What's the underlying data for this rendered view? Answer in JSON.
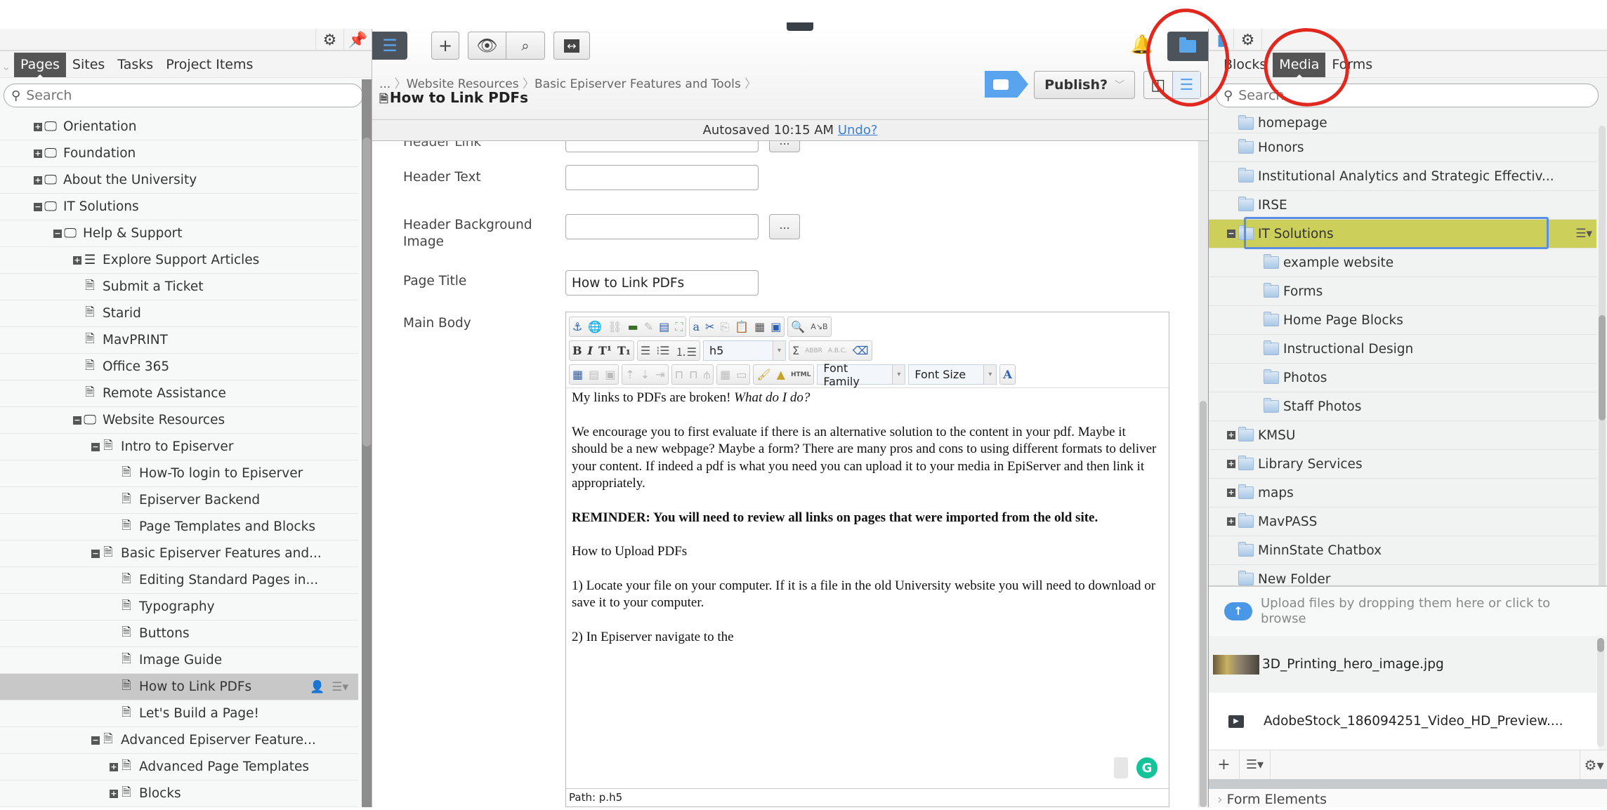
{
  "left_panel": {
    "tabs": [
      "Pages",
      "Sites",
      "Tasks",
      "Project Items"
    ],
    "active_tab": "Pages",
    "search_placeholder": "Search",
    "tree": [
      {
        "label": "Orientation",
        "level": 0,
        "type": "site",
        "expander": "plus"
      },
      {
        "label": "Foundation",
        "level": 0,
        "type": "site",
        "expander": "plus"
      },
      {
        "label": "About the University",
        "level": 0,
        "type": "site",
        "expander": "plus"
      },
      {
        "label": "IT Solutions",
        "level": 0,
        "type": "site",
        "expander": "minus"
      },
      {
        "label": "Help & Support",
        "level": 1,
        "type": "site",
        "expander": "minus"
      },
      {
        "label": "Explore Support Articles",
        "level": 2,
        "type": "list",
        "expander": "plus"
      },
      {
        "label": "Submit a Ticket",
        "level": 2,
        "type": "page",
        "expander": "none"
      },
      {
        "label": "Starid",
        "level": 2,
        "type": "page",
        "expander": "none"
      },
      {
        "label": "MavPRINT",
        "level": 2,
        "type": "page",
        "expander": "none"
      },
      {
        "label": "Office 365",
        "level": 2,
        "type": "page",
        "expander": "none"
      },
      {
        "label": "Remote Assistance",
        "level": 2,
        "type": "page",
        "expander": "none"
      },
      {
        "label": "Website Resources",
        "level": 2,
        "type": "site",
        "expander": "minus"
      },
      {
        "label": "Intro to Episerver",
        "level": 3,
        "type": "page",
        "expander": "minus"
      },
      {
        "label": "How-To login to Episerver",
        "level": 4,
        "type": "page",
        "expander": "none"
      },
      {
        "label": "Episerver Backend",
        "level": 4,
        "type": "page",
        "expander": "none"
      },
      {
        "label": "Page Templates and Blocks",
        "level": 4,
        "type": "page",
        "expander": "none"
      },
      {
        "label": "Basic Episerver Features and...",
        "level": 3,
        "type": "page",
        "expander": "minus"
      },
      {
        "label": "Editing Standard Pages in...",
        "level": 4,
        "type": "page",
        "expander": "none"
      },
      {
        "label": "Typography",
        "level": 4,
        "type": "page",
        "expander": "none"
      },
      {
        "label": "Buttons",
        "level": 4,
        "type": "page",
        "expander": "none"
      },
      {
        "label": "Image Guide",
        "level": 4,
        "type": "page",
        "expander": "none"
      },
      {
        "label": "How to Link PDFs",
        "level": 4,
        "type": "page",
        "expander": "none",
        "selected": true
      },
      {
        "label": "Let's Build a Page!",
        "level": 4,
        "type": "page",
        "expander": "none"
      },
      {
        "label": "Advanced Episerver Feature...",
        "level": 3,
        "type": "page",
        "expander": "minus"
      },
      {
        "label": "Advanced Page Templates",
        "level": 4,
        "type": "page",
        "expander": "plus"
      },
      {
        "label": "Blocks",
        "level": 4,
        "type": "page",
        "expander": "plus"
      }
    ]
  },
  "editor": {
    "breadcrumb": [
      "...",
      "Website Resources",
      "Basic Episerver Features and Tools"
    ],
    "page_title": "How to Link PDFs",
    "publish_label": "Publish?",
    "autosave_text": "Autosaved 10:15 AM",
    "undo_label": "Undo?",
    "fields": {
      "header_link_label": "Header Link",
      "header_text_label": "Header Text",
      "header_text_value": "",
      "header_bg_label": "Header Background Image",
      "header_bg_value": "",
      "page_title_label": "Page Title",
      "page_title_value": "How to Link PDFs",
      "main_body_label": "Main Body",
      "browse_label": "..."
    },
    "rte": {
      "block_format": "h5",
      "font_family": "Font Family",
      "font_size": "Font Size",
      "html_label": "HTML",
      "abbr_label": "ABBR",
      "acronym_label": "A.B.C.",
      "path": "Path: p.h5",
      "body": {
        "p1_plain": "My links to PDFs are broken! ",
        "p1_italic": "What do I do?",
        "p2": "We encourage you to first evaluate if there is an alternative solution to the content in your pdf. Maybe it should be a new webpage? Maybe a form? There are many pros and cons to using different formats to deliver your content. If indeed a pdf is what you need you can upload it to your media in EpiServer and then link it appropriately.",
        "p3": "REMINDER: You will need to review all links on pages that were imported from the old site.",
        "p4": "How to Upload PDFs",
        "p5": "1) Locate your file on your computer. If it is a file in the old University website you will need to download or save it to your computer.",
        "p6": "2) In Episerver navigate to the"
      }
    }
  },
  "right_panel": {
    "tabs": [
      "Blocks",
      "Media",
      "Forms"
    ],
    "active_tab": "Media",
    "search_placeholder": "Search",
    "folders": [
      {
        "label": "homepage",
        "level": 0,
        "expander": "none"
      },
      {
        "label": "Honors",
        "level": 0,
        "expander": "none"
      },
      {
        "label": "Institutional Analytics and Strategic Effectiv...",
        "level": 0,
        "expander": "none"
      },
      {
        "label": "IRSE",
        "level": 0,
        "expander": "none"
      },
      {
        "label": "IT Solutions",
        "level": 0,
        "expander": "minus",
        "highlight": true
      },
      {
        "label": "example website",
        "level": 1,
        "expander": "none"
      },
      {
        "label": "Forms",
        "level": 1,
        "expander": "none"
      },
      {
        "label": "Home Page Blocks",
        "level": 1,
        "expander": "none"
      },
      {
        "label": "Instructional Design",
        "level": 1,
        "expander": "none"
      },
      {
        "label": "Photos",
        "level": 1,
        "expander": "none"
      },
      {
        "label": "Staff Photos",
        "level": 1,
        "expander": "none"
      },
      {
        "label": "KMSU",
        "level": 0,
        "expander": "plus"
      },
      {
        "label": "Library Services",
        "level": 0,
        "expander": "plus"
      },
      {
        "label": "maps",
        "level": 0,
        "expander": "plus"
      },
      {
        "label": "MavPASS",
        "level": 0,
        "expander": "plus"
      },
      {
        "label": "MinnState Chatbox",
        "level": 0,
        "expander": "none"
      },
      {
        "label": "New Folder",
        "level": 0,
        "expander": "none"
      }
    ],
    "upload_text": "Upload files by dropping them here or click to browse",
    "files": [
      {
        "name": "3D_Printing_hero_image.jpg",
        "type": "image"
      },
      {
        "name": "AdobeStock_186094251_Video_HD_Preview....",
        "type": "video"
      }
    ],
    "form_elements_label": "Form Elements"
  },
  "colors": {
    "accent_blue": "#5aa3ee",
    "highlight_yellow": "#cccf5a",
    "dark_toggle": "#4d535a",
    "annotation_red": "#e0281e"
  }
}
